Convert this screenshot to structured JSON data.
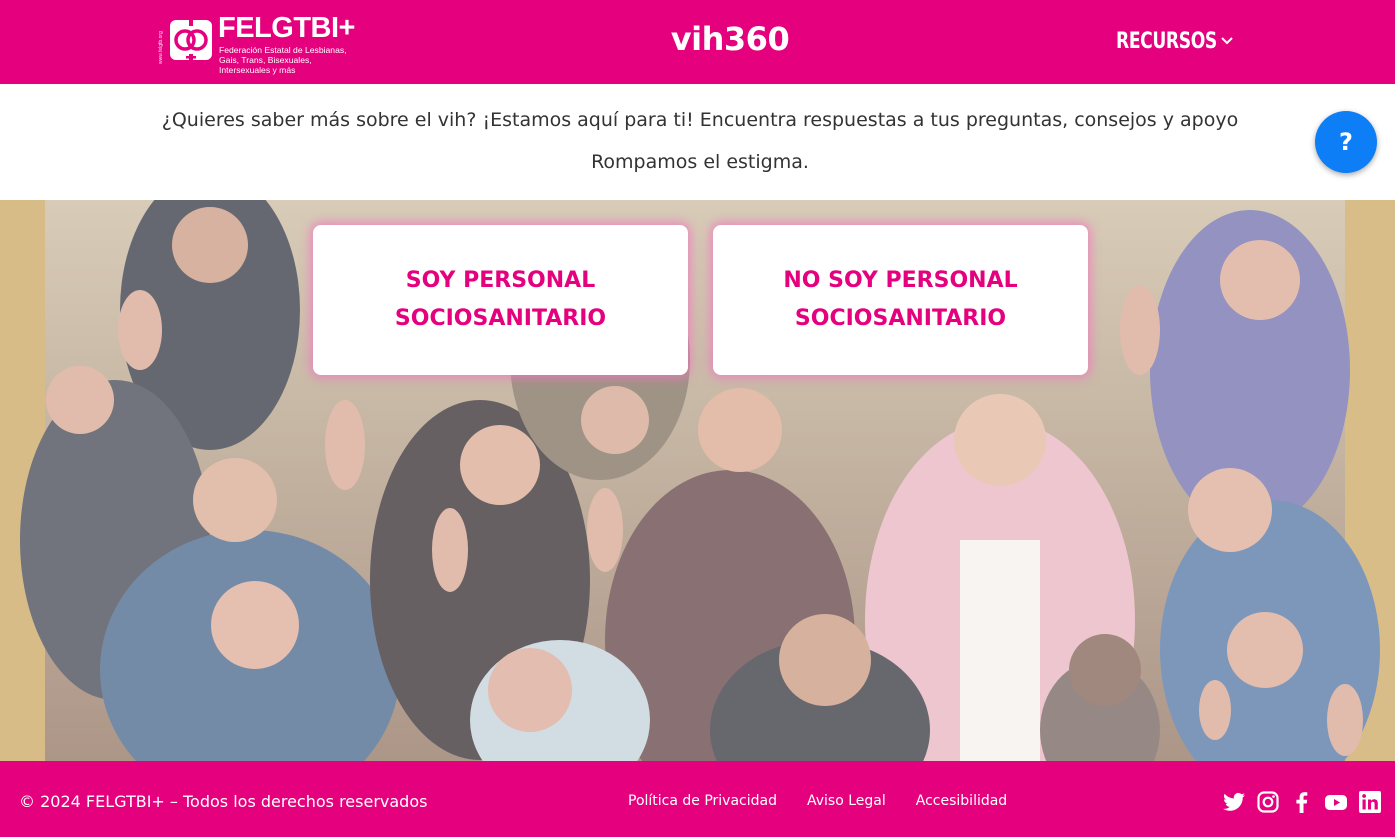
{
  "header": {
    "org_vertical_text": "www.felgtb.org",
    "org_name": "FELGTBI+",
    "org_tagline": "Federación Estatal de Lesbianas, Gais, Trans, Bisexuales, Intersexuales y más",
    "site_title": "vih360",
    "menu_label": "RECURSOS"
  },
  "intro": {
    "line1": "¿Quieres saber más sobre el vih? ¡Estamos aquí para ti! Encuentra respuestas a tus preguntas, consejos y apoyo",
    "line2": "Rompamos el estigma."
  },
  "help_button": {
    "label": "?"
  },
  "choices": [
    {
      "label": "SOY PERSONAL SOCIOSANITARIO"
    },
    {
      "label": "NO SOY PERSONAL SOCIOSANITARIO"
    }
  ],
  "footer": {
    "copyright": "© 2024 FELGTBI+ – Todos los derechos reservados",
    "links": [
      "Política de Privacidad",
      "Aviso Legal",
      "Accesibilidad"
    ],
    "social_icons": [
      "twitter-icon",
      "instagram-icon",
      "facebook-icon",
      "youtube-icon",
      "linkedin-icon"
    ]
  },
  "colors": {
    "brand_pink": "#e5007e",
    "help_blue": "#0d7ef5",
    "text_dark": "#333333",
    "white": "#ffffff"
  }
}
